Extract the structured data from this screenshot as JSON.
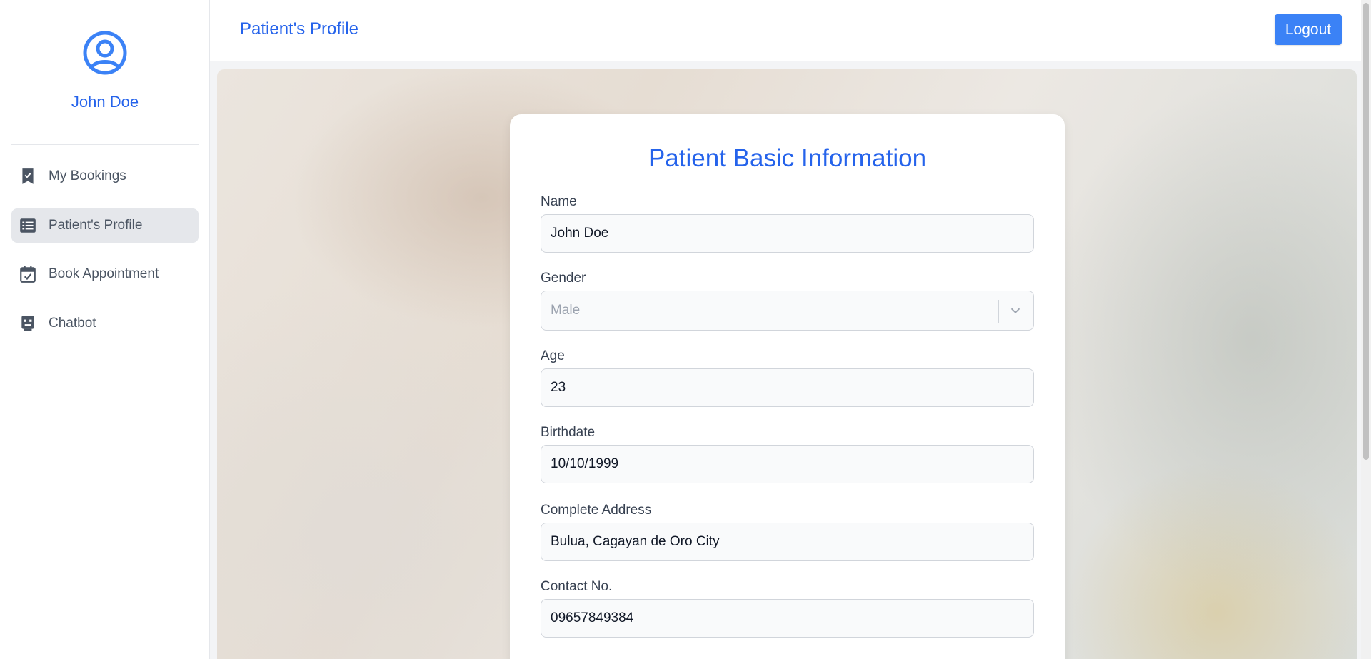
{
  "sidebar": {
    "user_name": "John Doe",
    "avatar_icon": "user-circle-icon",
    "items": [
      {
        "label": "My Bookings",
        "icon": "bookmark-check-icon",
        "active": false
      },
      {
        "label": "Patient's Profile",
        "icon": "list-icon",
        "active": true
      },
      {
        "label": "Book Appointment",
        "icon": "calendar-check-icon",
        "active": false
      },
      {
        "label": "Chatbot",
        "icon": "robot-icon",
        "active": false
      }
    ]
  },
  "header": {
    "title": "Patient's Profile",
    "logout_label": "Logout"
  },
  "form": {
    "title": "Patient Basic Information",
    "name": {
      "label": "Name",
      "value": "John Doe"
    },
    "gender": {
      "label": "Gender",
      "value": "Male"
    },
    "age": {
      "label": "Age",
      "value": "23"
    },
    "birthdate": {
      "label": "Birthdate",
      "value": "10/10/1999"
    },
    "address": {
      "label": "Complete Address",
      "value": "Bulua, Cagayan de Oro City"
    },
    "contact": {
      "label": "Contact No.",
      "value": "09657849384"
    }
  },
  "colors": {
    "accent": "#2563eb",
    "button": "#3b82f6",
    "active_nav": "#e5e7eb"
  }
}
